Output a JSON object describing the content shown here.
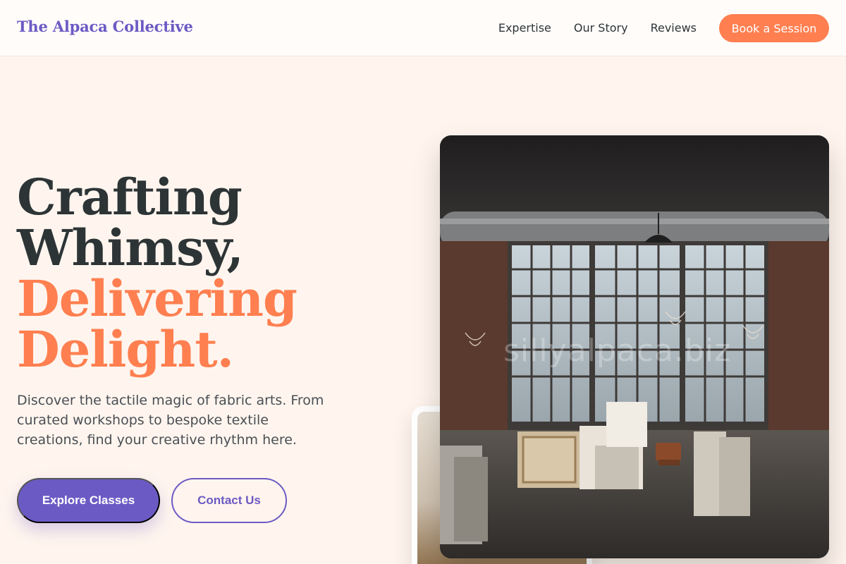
{
  "header": {
    "brand": "The Alpaca Collective",
    "nav": [
      {
        "label": "Expertise"
      },
      {
        "label": "Our Story"
      },
      {
        "label": "Reviews"
      }
    ],
    "cta_label": "Book a Session"
  },
  "hero": {
    "title_line1": "Crafting",
    "title_line2": "Whimsy,",
    "title_line3": "Delivering",
    "title_line4": "Delight.",
    "description": "Discover the tactile magic of fabric arts. From curated workshops to bespoke textile creations, find your creative rhythm here.",
    "primary_button": "Explore Classes",
    "secondary_button": "Contact Us"
  },
  "images": {
    "main_watermark": "sillyalpaca.biz"
  },
  "colors": {
    "brand": "#6c5ac4",
    "accent": "#ff7f50",
    "background": "#fff5ee",
    "text": "#2d3436"
  }
}
